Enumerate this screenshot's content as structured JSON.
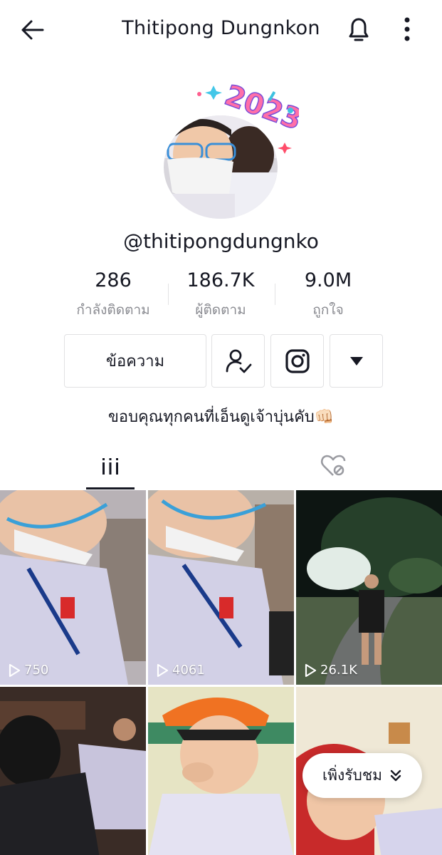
{
  "header": {
    "title": "Thitipong Dungnkon",
    "back_icon": "arrow-left-icon",
    "bell_icon": "bell-icon",
    "more_icon": "vertical-dots-icon"
  },
  "profile": {
    "username": "@thitipongdungnko",
    "avatar_badge_text": "2023",
    "bio": "ขอบคุณทุกคนที่เอ็นดูเจ้าบุ่นคับ👊🏻"
  },
  "stats": [
    {
      "value": "286",
      "label": "กำลังติดตาม"
    },
    {
      "value": "186.7K",
      "label": "ผู้ติดตาม"
    },
    {
      "value": "9.0M",
      "label": "ถูกใจ"
    }
  ],
  "actions": {
    "message_label": "ข้อความ",
    "following_icon": "user-check-icon",
    "instagram_icon": "instagram-icon",
    "dropdown_icon": "triangle-down-icon"
  },
  "tabs": {
    "videos_icon": "grid-bars-icon",
    "liked_icon": "heart-locked-icon",
    "active": "videos"
  },
  "videos": [
    {
      "views": "750"
    },
    {
      "views": "4061"
    },
    {
      "views": "26.1K"
    },
    {
      "views": ""
    },
    {
      "views": ""
    },
    {
      "views": ""
    }
  ],
  "watching_pill": {
    "label": "เพิ่งรับชม",
    "icon": "double-chevron-down-icon"
  },
  "colors": {
    "text_primary": "#161823",
    "text_secondary": "#8a8b91",
    "border": "#e1e1e3"
  }
}
